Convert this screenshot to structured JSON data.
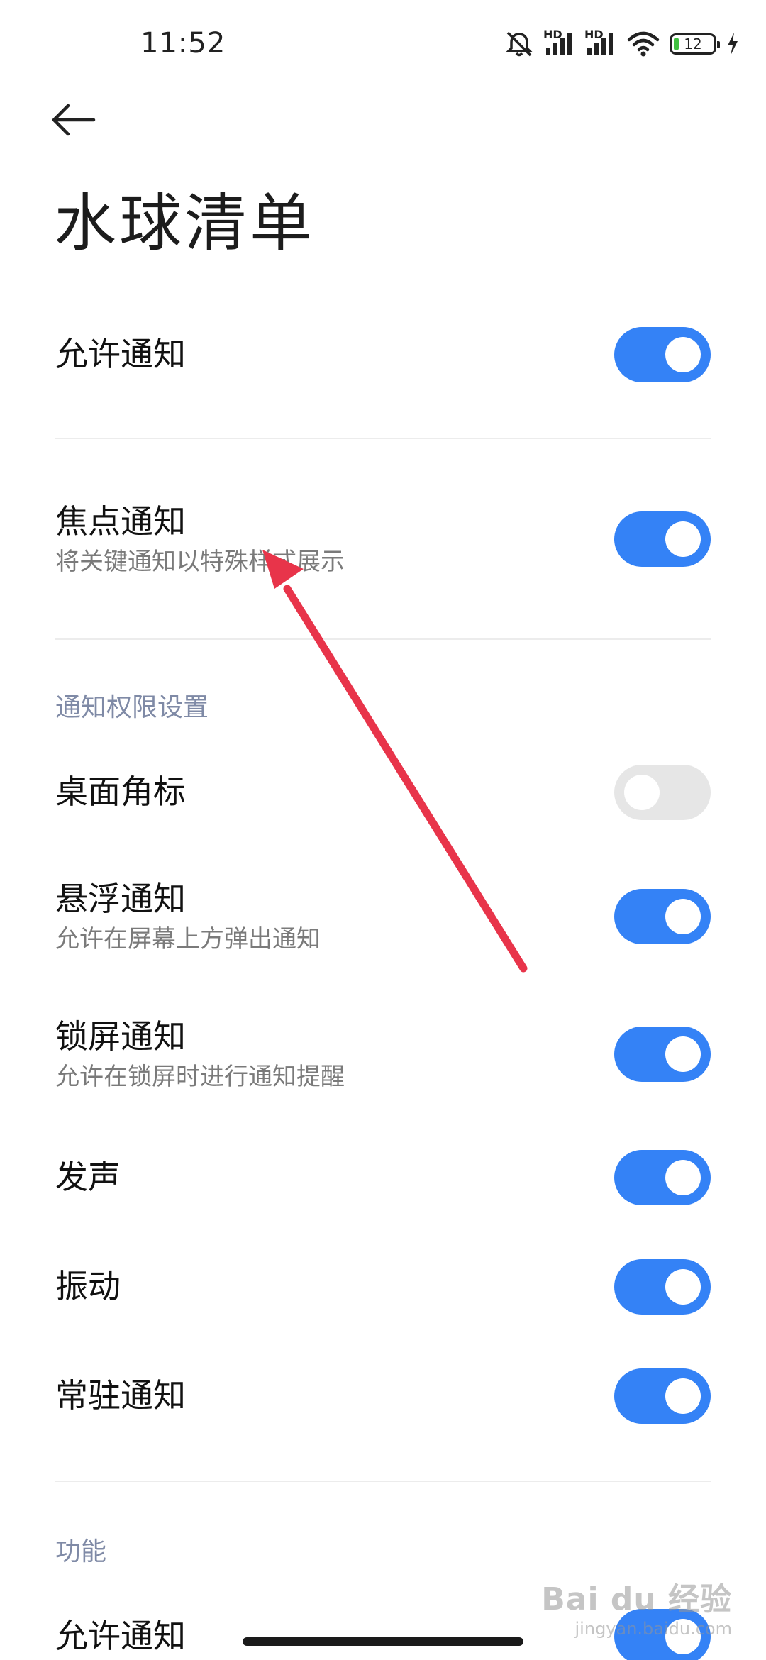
{
  "status_bar": {
    "time": "11:52",
    "hd_label_1": "HD",
    "hd_label_2": "HD",
    "battery_level": "12",
    "icons": [
      "bell-off-icon",
      "signal-icon",
      "signal-icon",
      "wifi-icon",
      "battery-icon",
      "charging-icon"
    ]
  },
  "header": {
    "title": "水球清单"
  },
  "rows": {
    "allow_notifications": {
      "title": "允许通知",
      "toggle": "on"
    },
    "focus_notifications": {
      "title": "焦点通知",
      "subtitle": "将关键通知以特殊样式展示",
      "toggle": "on"
    },
    "badge": {
      "title": "桌面角标",
      "toggle": "off"
    },
    "floating": {
      "title": "悬浮通知",
      "subtitle": "允许在屏幕上方弹出通知",
      "toggle": "on"
    },
    "lockscreen": {
      "title": "锁屏通知",
      "subtitle": "允许在锁屏时进行通知提醒",
      "toggle": "on"
    },
    "sound": {
      "title": "发声",
      "toggle": "on"
    },
    "vibrate": {
      "title": "振动",
      "toggle": "on"
    },
    "persistent": {
      "title": "常驻通知",
      "toggle": "on"
    },
    "feature_allow": {
      "title": "允许通知",
      "toggle": "on"
    }
  },
  "sections": {
    "permission_settings": "通知权限设置",
    "features": "功能"
  },
  "colors": {
    "toggle_on": "#3482f6",
    "toggle_off": "#e6e6e6",
    "section_header": "#7f8aa6",
    "annotation_arrow": "#e8344a"
  },
  "watermark": {
    "main": "Bai du 经验",
    "sub": "jingyan.baidu.com"
  }
}
